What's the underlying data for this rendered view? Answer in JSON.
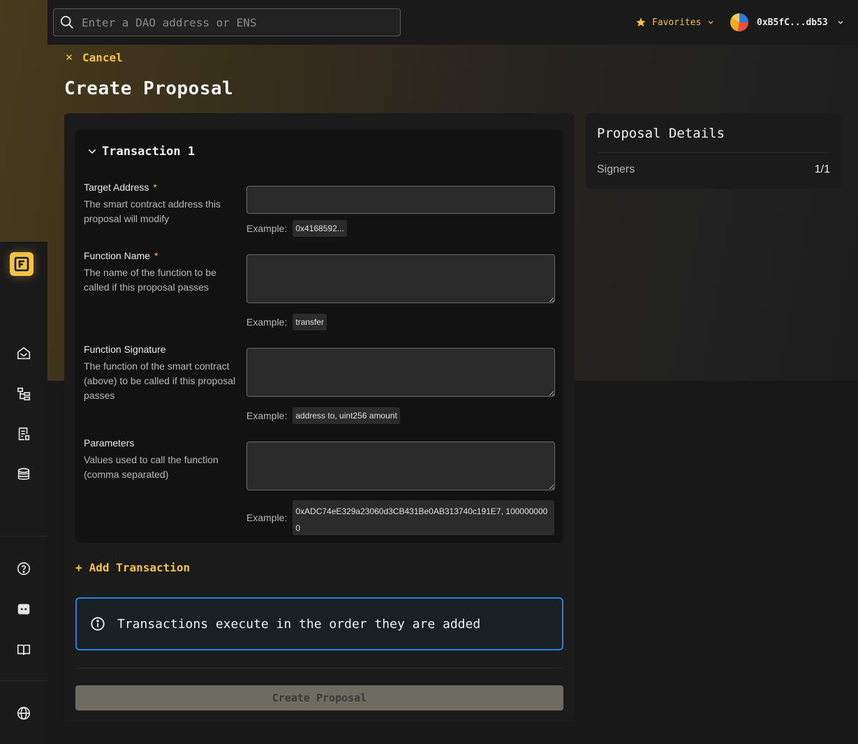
{
  "topbar": {
    "search_placeholder": "Enter a DAO address or ENS",
    "favorites_label": "Favorites",
    "account_address": "0xB5fC...db53"
  },
  "header": {
    "cancel_label": "Cancel",
    "page_title": "Create Proposal"
  },
  "transaction": {
    "title": "Transaction 1",
    "example_label": "Example:",
    "fields": [
      {
        "label": "Target Address",
        "required_mark": "*",
        "description": "The smart contract address this proposal will modify",
        "value": "",
        "example": "0x4168592..."
      },
      {
        "label": "Function Name",
        "required_mark": "*",
        "description": "The name of the function to be called if this proposal passes",
        "value": "",
        "example": "transfer"
      },
      {
        "label": "Function Signature",
        "description": "The function of the smart contract (above) to be called if this proposal passes",
        "value": "",
        "example": "address to, uint256 amount"
      },
      {
        "label": "Parameters",
        "description": "Values used to call the function (comma separated)",
        "value": "",
        "example": "0xADC74eE329a23060d3CB431Be0AB313740c191E7, 1000000000"
      }
    ]
  },
  "add_transaction_label": "Add Transaction",
  "info_message": "Transactions execute in the order they are added",
  "submit_label": "Create Proposal",
  "details": {
    "title": "Proposal Details",
    "signers_label": "Signers",
    "signers_value": "1/1"
  },
  "colors": {
    "accent": "#f5c242",
    "info_border": "#2b7de9",
    "background": "#151515"
  },
  "icons": {
    "sidebar": [
      "home-icon",
      "hierarchy-icon",
      "proposals-icon",
      "treasury-icon",
      "help-icon",
      "discord-icon",
      "docs-icon",
      "language-icon"
    ]
  }
}
